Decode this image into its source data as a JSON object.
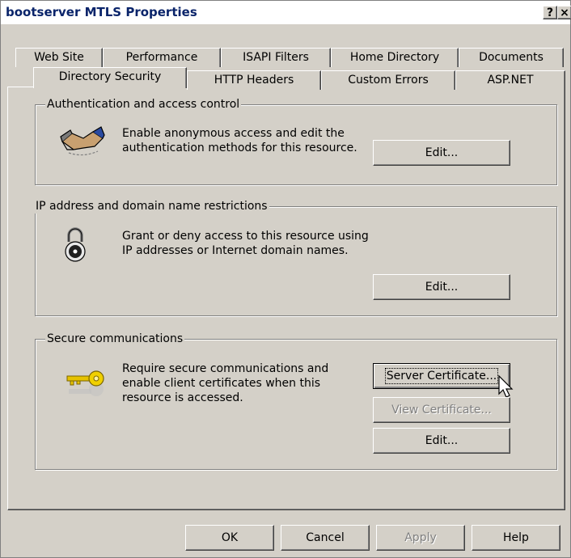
{
  "window": {
    "title": "bootserver MTLS Properties",
    "help_button": "?",
    "close_button": "×"
  },
  "tabs": {
    "row1": [
      "Web Site",
      "Performance",
      "ISAPI Filters",
      "Home Directory",
      "Documents"
    ],
    "row2": [
      "Directory Security",
      "HTTP Headers",
      "Custom Errors",
      "ASP.NET"
    ],
    "active": "Directory Security"
  },
  "groups": {
    "auth": {
      "legend": "Authentication and access control",
      "description": "Enable anonymous access and edit the\nauthentication methods for this resource.",
      "edit_button": "Edit...",
      "icon": "handshake-icon"
    },
    "ip": {
      "legend": "IP address and domain name restrictions",
      "description": "Grant or deny access to this resource using\nIP addresses or Internet domain names.",
      "edit_button": "Edit...",
      "icon": "padlock-icon"
    },
    "secure": {
      "legend": "Secure communications",
      "description": "Require secure communications and\nenable client certificates when this\nresource is accessed.",
      "server_cert_button": "Server Certificate...",
      "view_cert_button": "View Certificate...",
      "edit_button": "Edit...",
      "icon": "key-icon"
    }
  },
  "footer": {
    "ok": "OK",
    "cancel": "Cancel",
    "apply": "Apply",
    "help": "Help"
  }
}
